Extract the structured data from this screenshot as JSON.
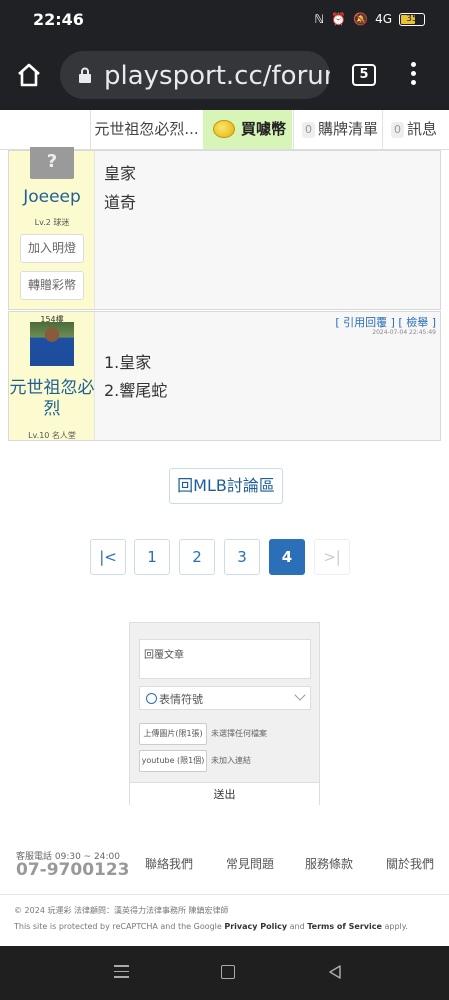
{
  "status_bar": {
    "time": "22:46",
    "battery": "35",
    "signal_text": "4G"
  },
  "browser": {
    "url": "playsport.cc/forur",
    "tab_count": "5"
  },
  "site_nav": {
    "user_link": "元世祖忽必烈...",
    "buy_coins": "買噱幣",
    "cart_count": "0",
    "cart_label": "購牌清單",
    "msg_count": "0",
    "msg_label": "訊息"
  },
  "posts": [
    {
      "username": "Joeeep",
      "level": "Lv.2 球迷",
      "buttons": [
        "加入明燈",
        "轉贈彩幣"
      ],
      "lines": [
        "皇家",
        "道奇"
      ]
    },
    {
      "floor": "154樓",
      "username": "元世祖忽必烈",
      "level": "Lv.10 名人堂",
      "actions": "[ 引用回覆 ]   [ 檢舉 ]",
      "date": "2024-07-04 22:45:49",
      "lines": [
        "1.皇家",
        "2.響尾蛇"
      ]
    }
  ],
  "back_button": "回MLB討論區",
  "pagination": {
    "first": "|<",
    "pages": [
      "1",
      "2",
      "3",
      "4"
    ],
    "current": 4,
    "last": ">|"
  },
  "reply": {
    "placeholder": "回覆文章",
    "emoji_label": "表情符號",
    "upload_image": "上傳圖片(限1張)",
    "upload_image_note": "未選擇任何檔案",
    "youtube": "youtube (限1個)",
    "youtube_note": "未加入連結",
    "submit": "送出"
  },
  "footer": {
    "hotline_label": "客服電話 09:30 ~ 24:00",
    "hotline": "07-9700123",
    "links": [
      "聯絡我們",
      "常見問題",
      "服務條款",
      "關於我們"
    ],
    "copyright": "© 2024 玩運彩  法律顧問：漢英得力法律事務所 陳鎮宏律師",
    "recaptcha_prefix": "This site is protected by reCAPTCHA and the Google",
    "privacy": "Privacy Policy",
    "and": "and",
    "terms": "Terms of Service",
    "apply": "apply."
  },
  "colors": {
    "link_blue": "#2a6fb8",
    "coin_green": "#d8f5b8",
    "user_panel": "#fcfbcf"
  }
}
